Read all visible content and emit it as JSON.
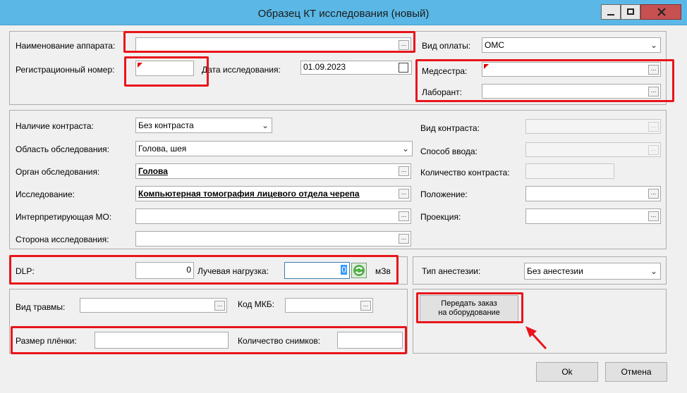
{
  "window": {
    "title": "Образец КТ исследования (новый)"
  },
  "header": {
    "device_label": "Наименование аппарата:",
    "device_value": "",
    "payment_label": "Вид оплаты:",
    "payment_value": "ОМС",
    "reg_label": "Регистрационный номер:",
    "reg_value": "",
    "date_label": "Дата исследования:",
    "date_value": "01.09.2023",
    "nurse_label": "Медсестра:",
    "nurse_value": "",
    "lab_label": "Лаборант:",
    "lab_value": ""
  },
  "study": {
    "contrast_presence_label": "Наличие контраста:",
    "contrast_presence_value": "Без контраста",
    "area_label": "Область обследования:",
    "area_value": "Голова, шея",
    "organ_label": "Орган обследования:",
    "organ_value": "Голова",
    "exam_label": "Исследование:",
    "exam_value": "Компьютерная томография лицевого отдела черепа",
    "interp_label": "Интерпретирующая МО:",
    "interp_value": "",
    "side_label": "Сторона исследования:",
    "side_value": "",
    "contrast_type_label": "Вид контраста:",
    "input_method_label": "Способ ввода:",
    "contrast_qty_label": "Количество контраста:",
    "position_label": "Положение:",
    "projection_label": "Проекция:"
  },
  "dose": {
    "dlp_label": "DLP:",
    "dlp_value": "0",
    "load_label": "Лучевая нагрузка:",
    "load_value": "0",
    "unit": "мЗв"
  },
  "anesthesia": {
    "label": "Тип анестезии:",
    "value": "Без анестезии"
  },
  "trauma": {
    "type_label": "Вид травмы:",
    "type_value": "",
    "mkb_label": "Код МКБ:",
    "mkb_value": ""
  },
  "film": {
    "size_label": "Размер плёнки:",
    "size_value": "",
    "count_label": "Количество снимков:",
    "count_value": ""
  },
  "actions": {
    "send_order_line1": "Передать заказ",
    "send_order_line2": "на оборудование",
    "ok": "Ok",
    "cancel": "Отмена"
  },
  "colors": {
    "titlebar": "#5bb8e6",
    "highlight": "#e8151b",
    "required_marker": "#e00000"
  }
}
